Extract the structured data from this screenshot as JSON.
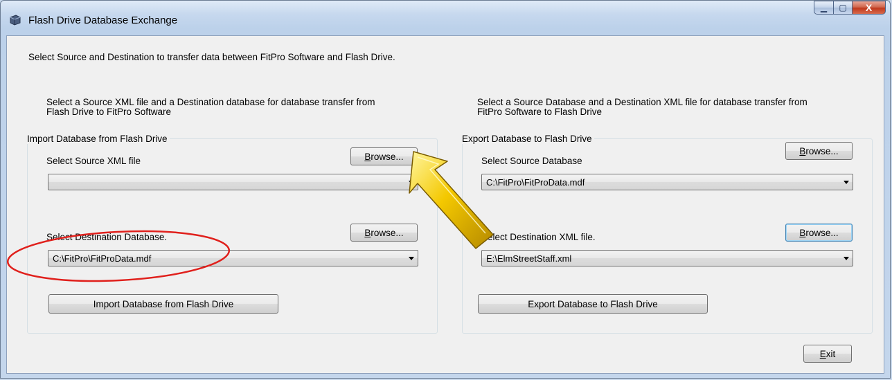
{
  "window": {
    "title": "Flash Drive Database Exchange",
    "caption_buttons": {
      "minimize": "▁",
      "maximize": "▢",
      "close": "X"
    }
  },
  "instructions": "Select Source and Destination to transfer data between FitPro Software and Flash Drive.",
  "import": {
    "description_line1": "Select a Source XML file and a Destination database for database transfer from",
    "description_line2": "Flash Drive to FitPro Software",
    "group_title": "Import Database from Flash Drive",
    "source_label": "Select Source XML file",
    "source_browse": {
      "mnemonic": "B",
      "rest": "rowse..."
    },
    "source_value": "",
    "destination_label": "Select Destination Database.",
    "destination_browse": {
      "mnemonic": "B",
      "rest": "rowse..."
    },
    "destination_value": "C:\\FitPro\\FitProData.mdf",
    "action_button": "Import Database from Flash Drive"
  },
  "export": {
    "description_line1": "Select a Source Database and a Destination XML file for database transfer from",
    "description_line2": "FitPro Software to Flash Drive",
    "group_title": "Export Database to Flash Drive",
    "source_label": "Select Source Database",
    "source_browse": {
      "mnemonic": "B",
      "rest": "rowse..."
    },
    "source_value": "C:\\FitPro\\FitProData.mdf",
    "destination_label": "Select Destination XML file.",
    "destination_browse": {
      "mnemonic": "B",
      "rest": "rowse..."
    },
    "destination_value": "E:\\ElmStreetStaff.xml",
    "action_button": "Export  Database to Flash Drive"
  },
  "exit_button": {
    "mnemonic": "E",
    "rest": "xit"
  },
  "colors": {
    "annotation_circle": "#e0201c",
    "annotation_arrow": "#f4c800",
    "focus_border": "#3c7fb1"
  }
}
